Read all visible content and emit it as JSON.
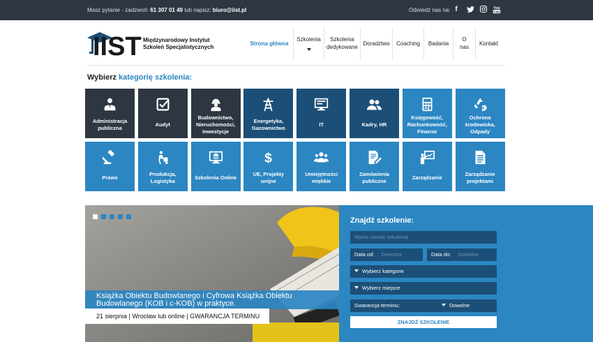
{
  "topbar": {
    "question": "Masz pytanie - zadzwoń:",
    "phone": "61 307 01 49",
    "or_write": "lub napisz:",
    "email": "biuro@iist.pl",
    "visit": "Odwiedź nas na:",
    "social": [
      {
        "icon": "facebook-icon",
        "glyph": "f"
      },
      {
        "icon": "twitter-icon",
        "glyph": "t"
      },
      {
        "icon": "instagram-icon",
        "glyph": "◎"
      },
      {
        "icon": "youtube-icon",
        "glyph": "You"
      }
    ]
  },
  "logo": {
    "mark": "IIST",
    "line1": "Międzynarodowy Instytut",
    "line2": "Szkoleń Specjalistycznych"
  },
  "nav": [
    {
      "label": "Strona główna",
      "active": true
    },
    {
      "label": "Szkolenia",
      "dropdown": true
    },
    {
      "label": "Szkolenia dedykowane"
    },
    {
      "label": "Doradztwo"
    },
    {
      "label": "Coaching"
    },
    {
      "label": "Badania"
    },
    {
      "label": "O nas"
    },
    {
      "label": "Kontakt"
    }
  ],
  "heading": {
    "prefix": "Wybierz",
    "highlight": "kategorię szkolenia:"
  },
  "categories": [
    {
      "label": "Administracja publiczna",
      "icon": "clerk-icon",
      "style": "dark"
    },
    {
      "label": "Audyt",
      "icon": "checkbox-icon",
      "style": "dark"
    },
    {
      "label": "Budownictwo, Nieruchomości, Inwestycje",
      "icon": "builder-icon",
      "style": "dark"
    },
    {
      "label": "Energetyka, Gazownictwo",
      "icon": "power-tower-icon",
      "style": "navy"
    },
    {
      "label": "IT",
      "icon": "monitor-icon",
      "style": "navy"
    },
    {
      "label": "Kadry, HR",
      "icon": "people-icon",
      "style": "navy"
    },
    {
      "label": "Księgowość, Rachunkowość, Finanse",
      "icon": "calculator-icon",
      "style": "blue"
    },
    {
      "label": "Ochrona środowiska, Odpady",
      "icon": "recycle-icon",
      "style": "blue"
    },
    {
      "label": "Prawo",
      "icon": "gavel-icon",
      "style": "blue"
    },
    {
      "label": "Produkcja, Logistyka",
      "icon": "handtruck-icon",
      "style": "blue"
    },
    {
      "label": "Szkolenia Online",
      "icon": "online-training-icon",
      "style": "blue"
    },
    {
      "label": "UE, Projekty unijne",
      "icon": "dollar-icon",
      "style": "blue"
    },
    {
      "label": "Umiejętności miękkie",
      "icon": "group-icon",
      "style": "blue"
    },
    {
      "label": "Zamówienia publiczne",
      "icon": "document-edit-icon",
      "style": "blue"
    },
    {
      "label": "Zarządzanie",
      "icon": "presentation-icon",
      "style": "blue"
    },
    {
      "label": "Zarządzanie projektami",
      "icon": "file-text-icon",
      "style": "blue"
    }
  ],
  "slider": {
    "caption": "Książka Obiektu Budowlanego i Cyfrowa Książka Obiektu Budowlanego (KOB i c-KOB) w praktyce.",
    "meta": "21 sierpnia | Wrocław lub online | GWARANCJA TERMINU",
    "dots": 5,
    "active_dot": 0
  },
  "search": {
    "title": "Znajdź szkolenie:",
    "name_placeholder": "Wpisz nazwę szkolenia",
    "date_from_label": "Data od:",
    "date_from_placeholder": "Dowolna",
    "date_to_label": "Data do:",
    "date_to_placeholder": "Dowolna",
    "category_select": "Wybierz kategorie",
    "place_select": "Wybierz miejsce",
    "guarantee_label": "Gwarancja terminu:",
    "guarantee_value": "Dowolne",
    "button": "ZNAJDŹ SZKOLENIE"
  },
  "colors": {
    "accent": "#2b86c2",
    "navy": "#1c4f77",
    "dark": "#2e3642"
  }
}
